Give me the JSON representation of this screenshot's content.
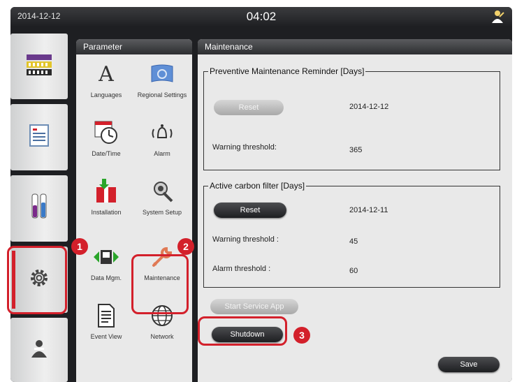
{
  "status_bar": {
    "date": "2014-12-12",
    "time": "04:02",
    "user_icon": "user-icon"
  },
  "sidebar": {
    "items": [
      {
        "name": "racks",
        "icon": "rack-icon"
      },
      {
        "name": "list",
        "icon": "list-icon"
      },
      {
        "name": "reagents",
        "icon": "reagent-tubes-icon"
      },
      {
        "name": "settings",
        "icon": "gear-icon",
        "active": true
      },
      {
        "name": "user",
        "icon": "user-icon"
      }
    ]
  },
  "parameter": {
    "title": "Parameter",
    "items": [
      {
        "label": "Languages",
        "icon": "letter-a-icon"
      },
      {
        "label": "Regional Settings",
        "icon": "globe-flag-icon"
      },
      {
        "label": "Date/Time",
        "icon": "clock-calendar-icon"
      },
      {
        "label": "Alarm",
        "icon": "bell-icon"
      },
      {
        "label": "Installation",
        "icon": "installation-icon"
      },
      {
        "label": "System Setup",
        "icon": "satellite-icon"
      },
      {
        "label": "Data Mgm.",
        "icon": "data-transfer-icon"
      },
      {
        "label": "Maintenance",
        "icon": "wrench-icon",
        "selected": true
      },
      {
        "label": "Event View",
        "icon": "document-icon"
      },
      {
        "label": "Network",
        "icon": "network-globe-icon"
      }
    ]
  },
  "maintenance": {
    "title": "Maintenance",
    "preventive": {
      "legend": "Preventive Maintenance Reminder [Days]",
      "reset_label": "Reset",
      "date": "2014-12-12",
      "warning_label": "Warning threshold:",
      "warning_value": "365"
    },
    "carbon": {
      "legend": "Active carbon filter [Days]",
      "reset_label": "Reset",
      "date": "2014-12-11",
      "warning_label": "Warning threshold :",
      "warning_value": "45",
      "alarm_label": "Alarm threshold :",
      "alarm_value": "60"
    },
    "start_service_label": "Start Service App",
    "shutdown_label": "Shutdown",
    "save_label": "Save"
  },
  "callouts": [
    "1",
    "2",
    "3"
  ],
  "colors": {
    "highlight": "#d3202b",
    "panel_bg": "#e9e9e9",
    "frame": "#1e1f22"
  }
}
